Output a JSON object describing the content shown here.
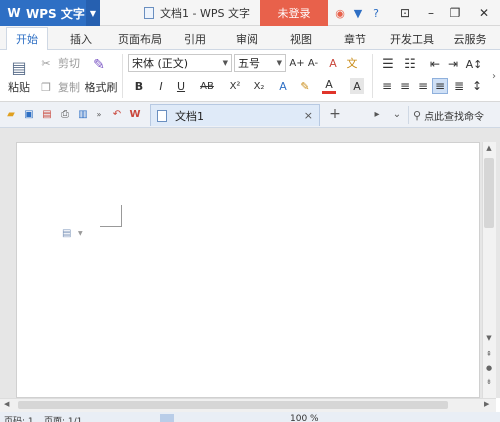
{
  "app": {
    "name": "WPS 文字",
    "logo": "W"
  },
  "window": {
    "doc_title": "文档1 - WPS 文字",
    "login_label": "未登录"
  },
  "tabs": [
    "开始",
    "插入",
    "页面布局",
    "引用",
    "审阅",
    "视图",
    "章节",
    "开发工具",
    "云服务"
  ],
  "clipboard": {
    "paste": "粘贴",
    "cut": "剪切",
    "copy": "复制",
    "format_painter": "格式刷"
  },
  "font": {
    "family": "宋体 (正文)",
    "size": "五号",
    "grow": "A+",
    "shrink": "A-",
    "clear": "A",
    "phonetic": "文"
  },
  "format": {
    "bold": "B",
    "italic": "I",
    "underline": "U",
    "strike": "AB",
    "superscript": "X²",
    "subscript": "X₂",
    "highlight": "A",
    "font_color": "A",
    "char_border": "A"
  },
  "document_tab": {
    "title": "文档1",
    "close": "×",
    "new": "+"
  },
  "search": {
    "label": "点此查找命令"
  },
  "status": {
    "page": "页码: 1",
    "pages": "页面: 1/1",
    "zoom": "100 %"
  },
  "colors": {
    "accent": "#2e6fc4",
    "login": "#e8614b",
    "qat_bg": "#eef1f6"
  }
}
